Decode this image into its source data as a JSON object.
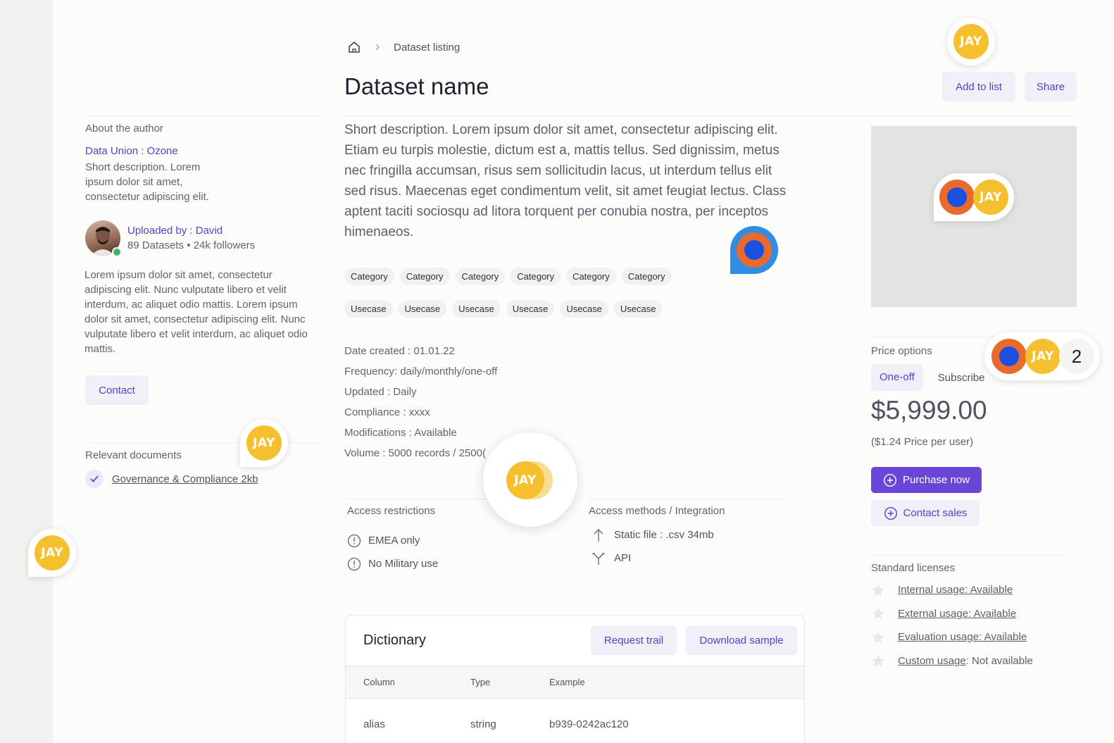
{
  "breadcrumb": {
    "home_icon": "home-icon",
    "chevron_icon": "chevron-right-icon",
    "current": "Dataset listing"
  },
  "page": {
    "title": "Dataset name"
  },
  "actions": {
    "add_to_list": "Add to list",
    "share": "Share"
  },
  "author": {
    "section_label": "About the author",
    "org_link": "Data Union : Ozone",
    "org_description": "Short description. Lorem ipsum dolor sit amet, consectetur adipiscing elit.",
    "uploader_link": "Uploaded by : David",
    "uploader_stats": "89 Datasets • 24k followers",
    "bio": "Lorem ipsum dolor sit amet, consectetur adipiscing elit. Nunc vulputate libero et velit interdum, ac aliquet odio mattis. Lorem ipsum dolor sit amet, consectetur adipiscing elit. Nunc vulputate libero et velit interdum, ac aliquet odio mattis.",
    "contact_button": "Contact",
    "online_color": "#3cb46e"
  },
  "documents": {
    "section_label": "Relevant documents",
    "items": [
      {
        "label": "Governance & Compliance 2kb",
        "icon": "check-icon"
      }
    ]
  },
  "description": "Short description. Lorem ipsum dolor sit amet, consectetur adipiscing elit. Etiam eu turpis molestie, dictum est a, mattis tellus. Sed dignissim, metus nec fringilla accumsan, risus sem sollicitudin lacus, ut interdum tellus elit sed risus. Maecenas eget condimentum velit, sit amet feugiat lectus. Class aptent taciti sociosqu ad litora torquent per conubia nostra, per inceptos himenaeos.",
  "categories": [
    "Category",
    "Category",
    "Category",
    "Category",
    "Category",
    "Category"
  ],
  "usecases": [
    "Usecase",
    "Usecase",
    "Usecase",
    "Usecase",
    "Usecase",
    "Usecase"
  ],
  "meta": [
    "Date created : 01.01.22",
    "Frequency: daily/monthly/one-off",
    "Updated : Daily",
    "Compliance : xxxx",
    "Modifications : Available",
    "Volume : 5000 records / 2500("
  ],
  "access_restrictions": {
    "label": "Access restrictions",
    "items": [
      "EMEA only",
      "No Military use"
    ],
    "icon": "alert-circle-icon"
  },
  "access_methods": {
    "label": "Access methods / Integration",
    "items": [
      {
        "label": "Static file : .csv 34mb",
        "icon": "arrow-up-icon"
      },
      {
        "label": "API",
        "icon": "fork-icon"
      }
    ]
  },
  "dictionary": {
    "title": "Dictionary",
    "request_trail": "Request trail",
    "download_sample": "Download sample",
    "columns": [
      "Column",
      "Type",
      "Example"
    ],
    "rows": [
      [
        "alias",
        "string",
        "b939-0242ac120"
      ]
    ]
  },
  "pricing": {
    "section_label": "Price options",
    "tabs": [
      "One-off",
      "Subscribe"
    ],
    "price": "$5,999.00",
    "per_user": "($1.24 Price per user)",
    "purchase_button": "Purchase now",
    "contact_sales_button": "Contact sales",
    "accent_color": "#6a45d8"
  },
  "licenses": {
    "section_label": "Standard licenses",
    "items": [
      {
        "link": "Internal usage: Available",
        "suffix": ""
      },
      {
        "link": "External usage: Available",
        "suffix": ""
      },
      {
        "link": "Evaluation usage: Available",
        "suffix": ""
      },
      {
        "link": "Custom usage",
        "suffix": " : Not available"
      }
    ],
    "icon": "star-icon"
  },
  "collaborators": {
    "jay_label": "JAY",
    "count_badge": "2",
    "jay_color": "#f4c02d",
    "pin_outer": "#e86a2c",
    "pin_inner": "#1a4fe0"
  }
}
